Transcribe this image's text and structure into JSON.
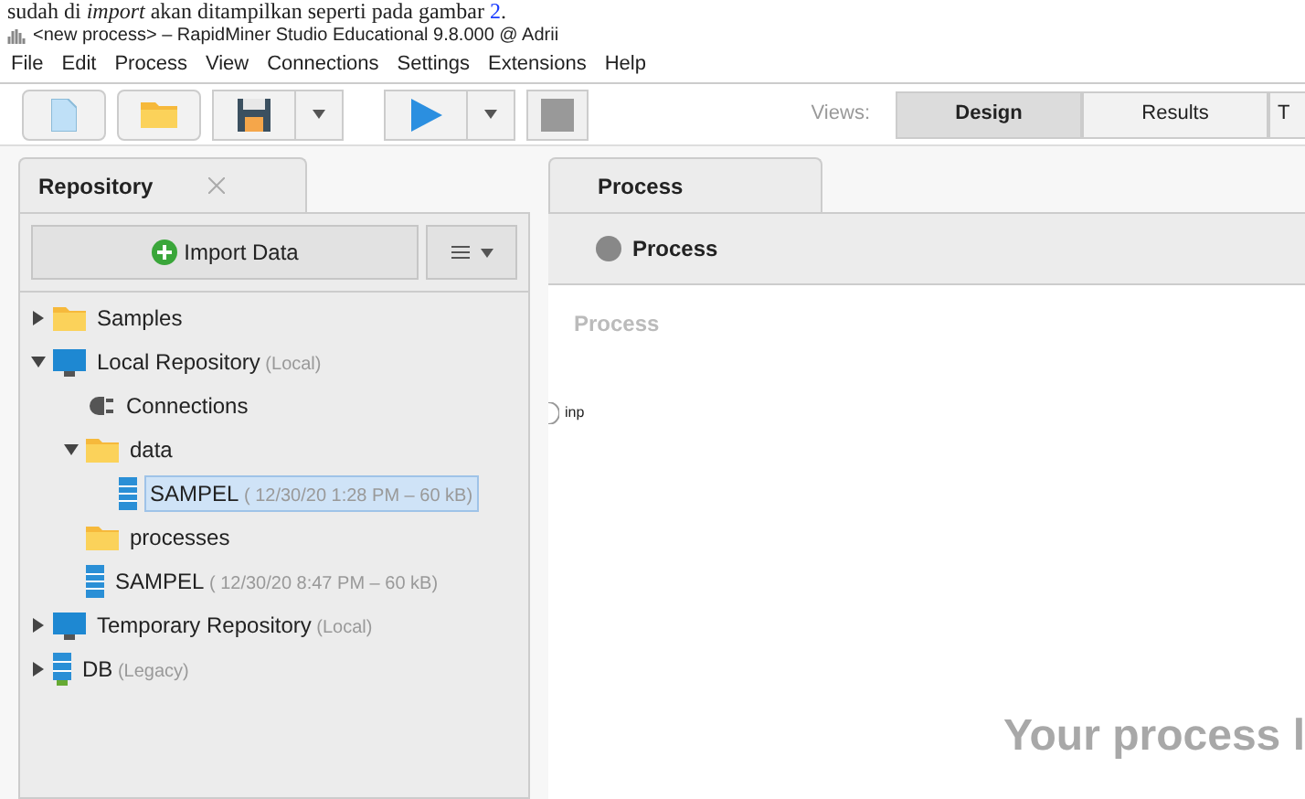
{
  "document_caption": {
    "text": "sudah di *import* akan ditampilkan seperti pada gambar",
    "link": "2",
    "end": "."
  },
  "window": {
    "title": "<new process> – RapidMiner Studio Educational 9.8.000 @ Adrii"
  },
  "menu": [
    "File",
    "Edit",
    "Process",
    "View",
    "Connections",
    "Settings",
    "Extensions",
    "Help"
  ],
  "views": {
    "label": "Views:",
    "tabs": [
      {
        "label": "Design",
        "selected": true
      },
      {
        "label": "Results",
        "selected": false
      },
      {
        "label": "T",
        "selected": false
      }
    ]
  },
  "repository": {
    "tab": "Repository",
    "import_button": "Import Data",
    "tree": [
      {
        "kind": "folder",
        "label": "Samples",
        "expanded": false,
        "selected": false
      },
      {
        "kind": "repository",
        "label": "Local Repository",
        "meta": "(Local)",
        "expanded": true,
        "selected": false,
        "children": [
          {
            "kind": "connections",
            "label": "Connections",
            "selected": false
          },
          {
            "kind": "folder",
            "label": "data",
            "expanded": true,
            "selected": false,
            "children": [
              {
                "kind": "data",
                "label": "SAMPEL",
                "meta": "( 12/30/20 1:28 PM – 60 kB)",
                "selected": true
              }
            ]
          },
          {
            "kind": "folder",
            "label": "processes",
            "selected": false
          },
          {
            "kind": "data",
            "label": "SAMPEL",
            "meta": "( 12/30/20 8:47 PM – 60 kB)",
            "selected": false
          }
        ]
      },
      {
        "kind": "repository",
        "label": "Temporary Repository",
        "meta": "(Local)",
        "expanded": false,
        "selected": false
      },
      {
        "kind": "db",
        "label": "DB",
        "meta": "(Legacy)",
        "expanded": false,
        "selected": false
      }
    ]
  },
  "process": {
    "tab": "Process",
    "breadcrumb": "Process",
    "canvas_label": "Process",
    "port": "inp",
    "hint": "Your process l"
  }
}
